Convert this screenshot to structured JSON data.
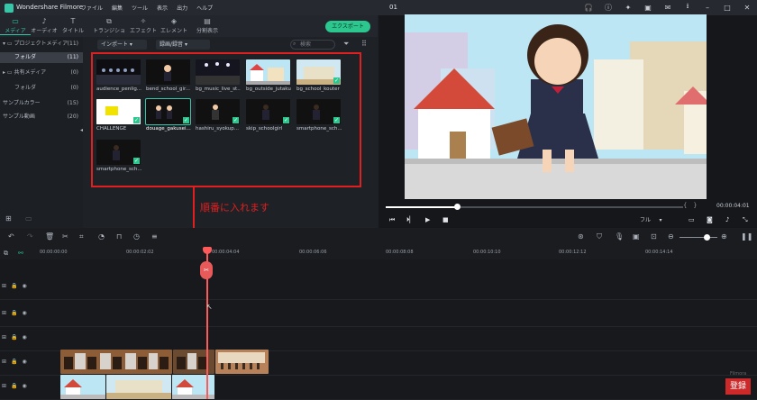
{
  "app": {
    "title": "Wondershare Filmore",
    "project": "01",
    "menu": [
      "ファイル",
      "編集",
      "ツール",
      "表示",
      "出力",
      "ヘルプ"
    ]
  },
  "toolbar": {
    "tabs": [
      "メディア",
      "オーディオ",
      "タイトル",
      "トランジション",
      "エフェクト",
      "エレメント",
      "分割表示"
    ],
    "export_label": "エクスポート"
  },
  "library": {
    "items": [
      {
        "label": "プロジェクトメディア",
        "count": "(11)"
      },
      {
        "label": "フォルダ",
        "count": "(11)"
      },
      {
        "label": "共有メディア",
        "count": "(0)"
      },
      {
        "label": "フォルダ",
        "count": "(0)"
      },
      {
        "label": "サンプルカラー",
        "count": "(15)"
      },
      {
        "label": "サンプル動画",
        "count": "(20)"
      }
    ]
  },
  "media": {
    "import_label": "インポート",
    "record_label": "録画/録音",
    "search_placeholder": "検索",
    "clips": [
      "audience_penlig...",
      "bend_school_gir...",
      "bg_music_live_st...",
      "bg_outside_jutaku",
      "bg_school_kouter",
      "CHALLENGE",
      "douage_gakusei...",
      "hashiru_syokup...",
      "skip_schoolgirl",
      "smartphone_sch...",
      "smartphone_sch..."
    ]
  },
  "annotation": "順番に入れます",
  "preview": {
    "timecode": "00:00:04:01",
    "quality": "フル",
    "progress": 0.24
  },
  "timeline": {
    "ruler": [
      "00:00:00:00",
      "00:00:02:02",
      "00:00:04:04",
      "00:00:06:06",
      "00:00:08:08",
      "00:00:10:10",
      "00:00:12:12",
      "00:00:14:14"
    ]
  },
  "badge": "登録",
  "watermark": "Filmora"
}
